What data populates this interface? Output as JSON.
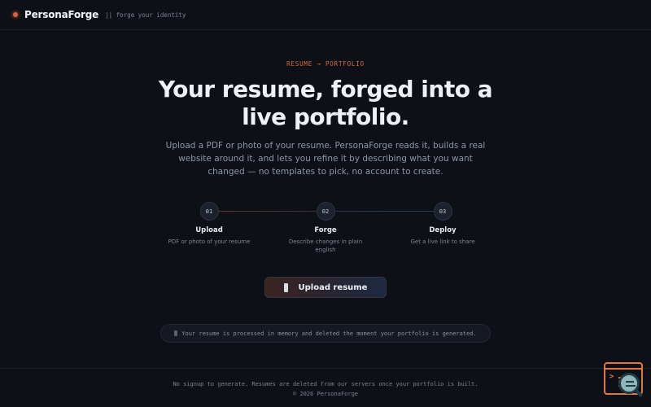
{
  "header": {
    "brand_name": "PersonaForge",
    "tagline": "|| forge your identity",
    "accent_color": "#e0603a"
  },
  "hero": {
    "eyebrow": "RESUME → PORTFOLIO",
    "headline": "Your resume, forged into a live portfolio.",
    "subtext": "Upload a PDF or photo of your resume. PersonaForge reads it, builds a real website around it, and lets you refine it by describing what you want changed — no templates to pick, no account to create."
  },
  "steps": [
    {
      "number": "01",
      "title": "Upload",
      "description": "PDF or photo of your resume"
    },
    {
      "number": "02",
      "title": "Forge",
      "description": "Describe changes in plain english"
    },
    {
      "number": "03",
      "title": "Deploy",
      "description": "Get a live link to share"
    }
  ],
  "upload_button": {
    "label": "Upload resume",
    "icon": "file-icon"
  },
  "privacy_note": {
    "icon": "lock-icon",
    "text": "Your resume is processed in memory and deleted the moment your portfolio is generated."
  },
  "footer": {
    "line1": "No signup to generate. Resumes are deleted from our servers once your portfolio is built.",
    "line2": "© 2026 PersonaForge"
  },
  "floating_widget": {
    "icon": "code-search-icon"
  }
}
